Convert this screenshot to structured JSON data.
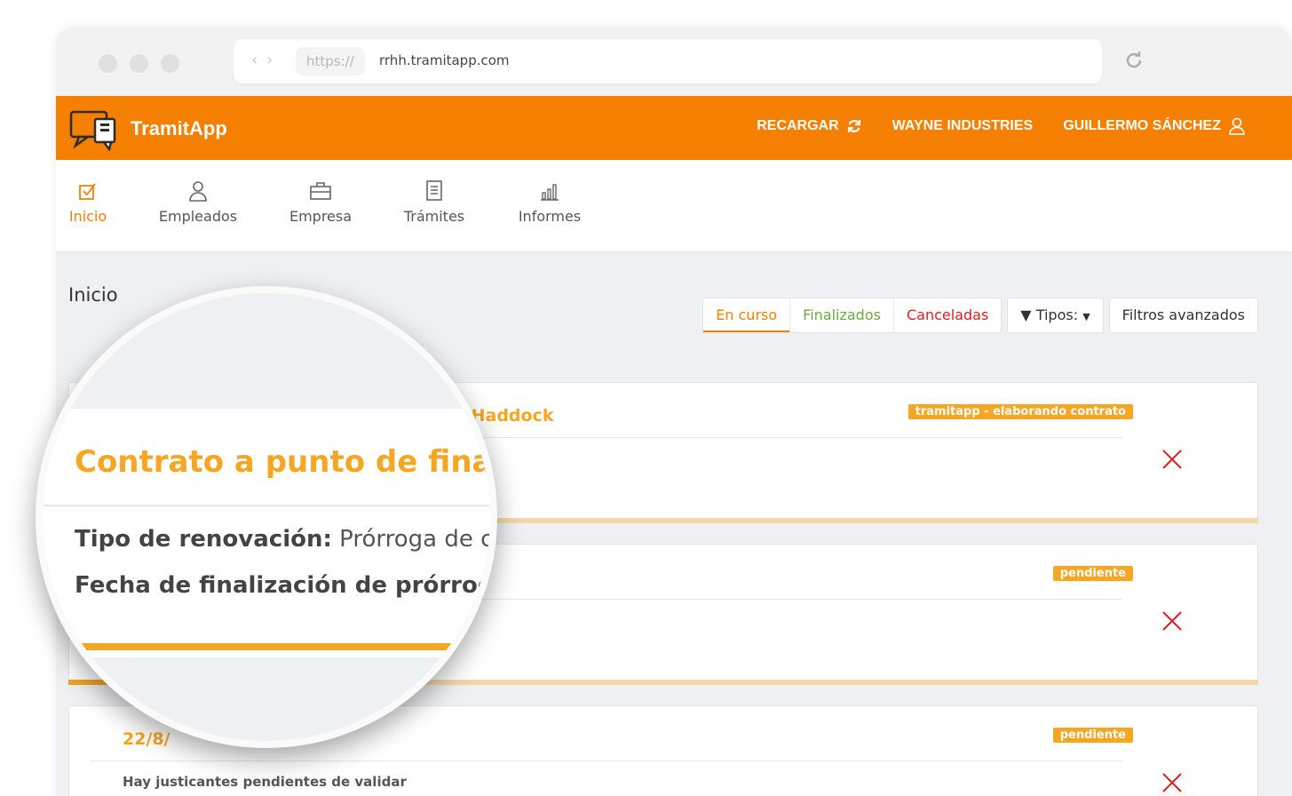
{
  "browser": {
    "protocol": "https://",
    "domain": "rrhh.tramitapp.com"
  },
  "topbar": {
    "brand": "TramitApp",
    "links": [
      "RECARGAR",
      "WAYNE INDUSTRIES",
      "GUILLERMO SÁNCHEZ"
    ]
  },
  "nav": {
    "items": [
      {
        "label": "Inicio",
        "icon": "checkbox-icon"
      },
      {
        "label": "Empleados",
        "icon": "user-icon"
      },
      {
        "label": "Empresa",
        "icon": "briefcase-icon"
      },
      {
        "label": "Trámites",
        "icon": "document-icon"
      },
      {
        "label": "Informes",
        "icon": "bar-chart-icon"
      }
    ]
  },
  "page": {
    "title": "Inicio",
    "filters": {
      "en_curso": "En curso",
      "finalizados": "Finalizados",
      "canceladas": "Canceladas",
      "tipos": "Tipos:",
      "avanzados": "Filtros avanzados"
    }
  },
  "cards": [
    {
      "title": "aldo Haddock",
      "badge": "tramitapp - elaborando contrato",
      "progress": 0.3,
      "body": ""
    },
    {
      "title": "",
      "badge": "pendiente",
      "progress": 0.3,
      "body": ""
    },
    {
      "title": "22/8/",
      "badge": "pendiente",
      "progress": 0,
      "body": "Hay justicantes pendientes de validar"
    }
  ],
  "magnifier": {
    "title": "Contrato a punto de finalizar",
    "row1_label": "Tipo de renovación:",
    "row1_value": "Prórroga de con",
    "row2_label": "Fecha de finalización de prórroga:"
  },
  "colors": {
    "brand": "#f57f00",
    "accent": "#f5a623",
    "success": "#6aab3f",
    "danger": "#e02020"
  }
}
